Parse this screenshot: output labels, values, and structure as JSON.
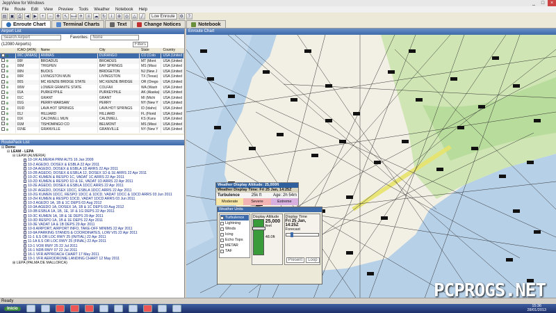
{
  "window": {
    "title": "JeppView for Windows",
    "minimize": "_",
    "maximize": "□",
    "close": "×"
  },
  "menu": [
    "File",
    "Route",
    "Edit",
    "View",
    "Preview",
    "Tools",
    "Weather",
    "Notebook",
    "Help"
  ],
  "toolbar": {
    "dropdown": "Low Enroute"
  },
  "tabs": [
    {
      "label": "Enroute Chart",
      "icon": "globe-icon",
      "color": "#2f6fb5"
    },
    {
      "label": "Terminal Charts",
      "icon": "chart-icon",
      "color": "#5588cc"
    },
    {
      "label": "Text",
      "icon": "text-icon",
      "color": "#666666"
    },
    {
      "label": "Change Notices",
      "icon": "change-notices-icon",
      "color": "#c03030"
    },
    {
      "label": "Notebook",
      "icon": "notebook-icon",
      "color": "#6a8f3a"
    }
  ],
  "airport_list": {
    "header": "Airport List",
    "search_placeholder": "Search Airport",
    "favorites_label": "Favorites:",
    "favorites_value": "None",
    "count": "(12080 Airports)",
    "filters_label": "Filters",
    "columns": [
      "ICAO (IATA)",
      "Name",
      "City",
      "State",
      "Country"
    ],
    "rows": [
      [
        "00C (ANIAS)",
        "ANIMAS",
        "DURANGO",
        "CO (Colo",
        "USA (United"
      ],
      [
        "00F",
        "BROADUS",
        "BROADUS",
        "MT (Mont",
        "USA (United"
      ],
      [
        "00M",
        "THIGPEN",
        "BAY SPRINGS",
        "MS (Missi",
        "USA (United"
      ],
      [
        "00N",
        "BUCKS",
        "BRIDGETON",
        "NJ (New J",
        "USA (United"
      ],
      [
        "00R",
        "LIVINGSTON MUN",
        "LIVINGSTON",
        "TX (Texas)",
        "USA (United"
      ],
      [
        "00S",
        "MC KENZIE BRIDGE STATE",
        "MC KENZIE BRIDGE",
        "OR (Orego",
        "USA (United"
      ],
      [
        "00W",
        "LOWER GRANITE STATE",
        "COLFAX",
        "WA (Wash",
        "USA (United"
      ],
      [
        "01A",
        "PURKEYPILE",
        "PURKEYPILE",
        "AK (Alaska)",
        "USA (United"
      ],
      [
        "01C",
        "GRANT",
        "GRANT",
        "MI (Michi",
        "USA (United"
      ],
      [
        "01G",
        "PERRY-WARSAW",
        "PERRY",
        "NY (New Y",
        "USA (United"
      ],
      [
        "01ID",
        "LAVA HOT SPRINGS",
        "LAVA HOT SPRINGS",
        "ID (Idaho)",
        "USA (United"
      ],
      [
        "01J",
        "HILLIARD",
        "HILLIARD",
        "FL (Florid",
        "USA (United"
      ],
      [
        "01K",
        "CALDWELL MUN",
        "CALDWELL",
        "KS (Kans",
        "USA (United"
      ],
      [
        "01M",
        "TISHOMINGO CO",
        "BELMONT",
        "MS (Missi",
        "USA (United"
      ],
      [
        "01NE",
        "GRANVILLE",
        "GRANVILLE",
        "NY (New Y",
        "USA (United"
      ]
    ]
  },
  "route_pack": {
    "header": "RoutePack List",
    "root": "Demo",
    "route": "LEAM - LEPA",
    "airport": "LEAM (ALMERIA)",
    "charts": [
      "10-1R ALMERIA PRM ALTS 16 Jan 2009",
      "10-2 AGEDO, DOSEX & ESBLA 22 Apr 2011",
      "10-2A AGEDO, DOSEX & ESBLA 1D ARRS 22 Apr 2011",
      "10-2B AGEDO, DOSEX & ESBLA 12, DOSEX 1D & 1E ARRS 22 Apr 2011",
      "10-2C KUMEN & RESPO 1C, VADAT 1C ARRS 22 Apr 2011",
      "10-2D KUMEN & RESPO 1D & 1E, VADAT 1D ARRS 22 Apr 2011",
      "10-2E AGEDO, DOSEX & ESBLA 1DCC ARRS 22 Apr 2011",
      "10-2F AGEDO, DOSEX 1DCC, ESBLA 1DCC ARRS 22 Apr 2011",
      "10-2G KUMEN 1DCC, RESPO 1DCC & 1DCD, VADAT 1DCC & 1DCD ARRS 03 Jun 2011",
      "10-2H KUMEN & RESPO 1DCD, VADAT 1DCD ARRS 03 Jun 2011",
      "10-3 AGEDO 1A, 1B & 1C DEPS 03 Aug 2012",
      "10-3A AGEDO 1A, DOSEX 1A, 1B & 1C DEPS 03 Aug 2012",
      "10-3B ESBLA 1A, 1B, 1E, 1F & 1G DEPS 22 Apr 2011",
      "10-3C KUMEN 1A, 1B & 1E DEPS 29 Apr 2011",
      "10-3D RESPO 1A, 1B & 1E DEPS 22 Apr 2011",
      "10-3E VADAT 1A & 1B DEPS 29 Apr 2011",
      "10-9 AIRPORT, AIRPORT INFO, TAKE-OFF MINIMS 22 Apr 2011",
      "10-9A PARKING STANDS & COORDINATES, LOW VIS 22 Apr 2011",
      "11-1 ILS OR LOC RWY 25 (INITIAL) 22 Apr 2011",
      "11-1A ILS OR LOC RWY 25 (FINAL) 22 Apr 2011",
      "13-1 VOR RWY 25 22 Jul 2011",
      "16-1 NDB RWY 07 22 Jul 2011",
      "16-1 VFR APPROACH CHART 17 May 2011",
      "19-1 VFR AERODROME LANDING CHART 12 May 2011"
    ],
    "airport2": "LEPA (PALMA DE MALLORCA)"
  },
  "map": {
    "header": "Enroute Chart",
    "land_color": "#f2efe4",
    "sea_color": "#b6d0e8",
    "green_color": "#cfe6b4"
  },
  "weather_popup": {
    "line1": "Weather Display Altitude: 25,000ft",
    "line2": "Weather Display Time: Fri 25 Jan, 14:25Z",
    "turb_label": "Turbulence",
    "turb_alt": "25k ft",
    "turb_age": "Age: 2h 54m",
    "levels": [
      "Moderate",
      "Severe",
      "Extreme"
    ]
  },
  "weather_panel": {
    "title": "Weather Units",
    "units": [
      "Turbulence",
      "Lightning",
      "Winds",
      "Icing",
      "Echo Tops",
      "METAR",
      "TAF"
    ],
    "alt_label": "Display Altitude",
    "alt_value": "25,000",
    "alt_unit": "feet",
    "alt_hint": "48.0ft",
    "time_label": "Display Time",
    "time_value": "Fri 25 Jan, 14:25Z",
    "time_sub": "Forecast",
    "present_button": "Present",
    "loop_button": "Loop"
  },
  "status": "Ready",
  "taskbar": {
    "start": "Inicio",
    "time": "15:36",
    "date": "28/01/2013"
  },
  "watermark": "PCPROGS.NET"
}
